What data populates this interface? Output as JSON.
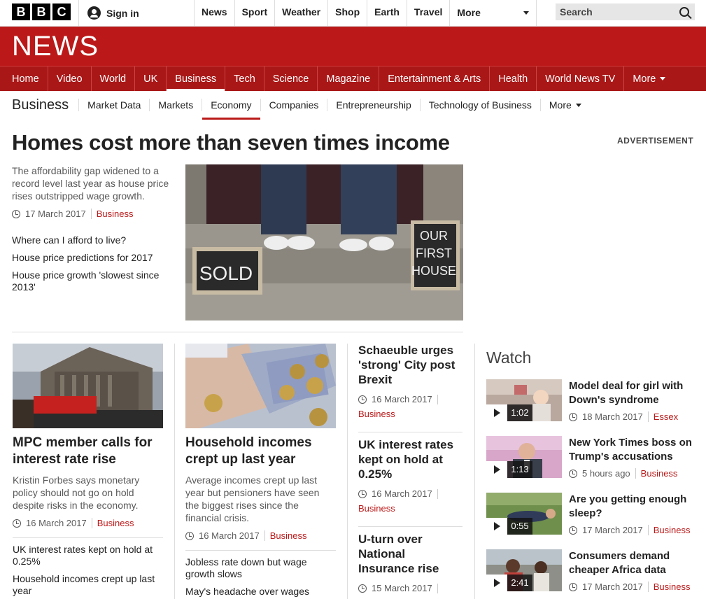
{
  "top": {
    "logo_letters": [
      "B",
      "B",
      "C"
    ],
    "signin": "Sign in",
    "nav": [
      "News",
      "Sport",
      "Weather",
      "Shop",
      "Earth",
      "Travel"
    ],
    "more": "More",
    "search_placeholder": "Search"
  },
  "masthead": {
    "title": "NEWS"
  },
  "main_nav": {
    "items": [
      "Home",
      "Video",
      "World",
      "UK",
      "Business",
      "Tech",
      "Science",
      "Magazine",
      "Entertainment & Arts",
      "Health",
      "World News TV"
    ],
    "active": "Business",
    "more": "More"
  },
  "sub_nav": {
    "section": "Business",
    "items": [
      "Market Data",
      "Markets",
      "Economy",
      "Companies",
      "Entrepreneurship",
      "Technology of Business"
    ],
    "active": "Economy",
    "more": "More"
  },
  "advert_label": "ADVERTISEMENT",
  "lead": {
    "title": "Homes cost more than seven times income",
    "summary": "The affordability gap widened to a record level last year as house price rises outstripped wage growth.",
    "date": "17 March 2017",
    "section": "Business",
    "related": [
      "Where can I afford to live?",
      "House price predictions for 2017",
      "House price growth 'slowest since 2013'"
    ],
    "image": {
      "sign_sold": "SOLD",
      "sign_house": [
        "OUR",
        "FIRST",
        "HOUSE"
      ]
    }
  },
  "cards": [
    {
      "title": "MPC member calls for interest rate rise",
      "summary": "Kristin Forbes says monetary policy should not go on hold despite risks in the economy.",
      "date": "16 March 2017",
      "section": "Business",
      "related": [
        "UK interest rates kept on hold at 0.25%",
        "Household incomes crept up last year"
      ]
    },
    {
      "title": "Household incomes crept up last year",
      "summary": "Average incomes crept up last year but pensioners have seen the biggest rises since the financial crisis.",
      "date": "16 March 2017",
      "section": "Business",
      "related": [
        "Jobless rate down but wage growth slows",
        "May's headache over wages"
      ]
    }
  ],
  "column3": [
    {
      "title": "Schaeuble urges 'strong' City post Brexit",
      "date": "16 March 2017",
      "section": "Business"
    },
    {
      "title": "UK interest rates kept on hold at 0.25%",
      "date": "16 March 2017",
      "section": "Business"
    },
    {
      "title": "U-turn over National Insurance rise",
      "date": "15 March 2017",
      "section": ""
    }
  ],
  "watch": {
    "heading": "Watch",
    "items": [
      {
        "title": "Model deal for girl with Down's syndrome",
        "duration": "1:02",
        "date": "18 March 2017",
        "section": "Essex"
      },
      {
        "title": "New York Times boss on Trump's accusations",
        "duration": "1:13",
        "date": "5 hours ago",
        "section": "Business"
      },
      {
        "title": "Are you getting enough sleep?",
        "duration": "0:55",
        "date": "17 March 2017",
        "section": "Business"
      },
      {
        "title": "Consumers demand cheaper Africa data",
        "duration": "2:41",
        "date": "17 March 2017",
        "section": "Business"
      }
    ]
  },
  "colors": {
    "brand_red": "#bb1919",
    "nav_red": "#a91717",
    "text": "#222222",
    "muted": "#5a5a5a"
  }
}
